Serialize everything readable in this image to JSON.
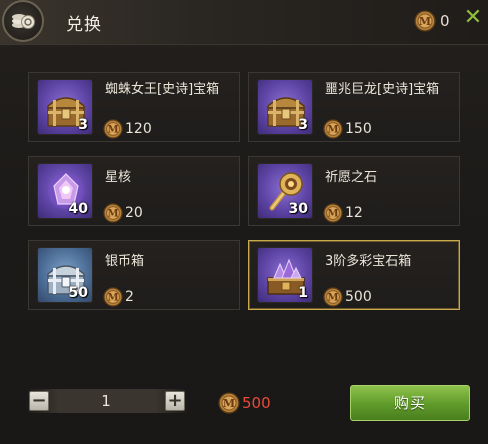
{
  "header": {
    "title": "兑换",
    "balance": "0",
    "close_symbol": "✕"
  },
  "items": [
    {
      "name": "蜘蛛女王[史诗]宝箱",
      "qty": "3",
      "price": "120",
      "icon": "spider-queen-chest-icon"
    },
    {
      "name": "噩兆巨龙[史诗]宝箱",
      "qty": "3",
      "price": "150",
      "icon": "omen-dragon-chest-icon"
    },
    {
      "name": "星核",
      "qty": "40",
      "price": "20",
      "icon": "star-core-icon"
    },
    {
      "name": "祈愿之石",
      "qty": "30",
      "price": "12",
      "icon": "wish-stone-icon"
    },
    {
      "name": "银币箱",
      "qty": "50",
      "price": "2",
      "icon": "silver-coin-chest-icon"
    },
    {
      "name": "3阶多彩宝石箱",
      "qty": "1",
      "price": "500",
      "icon": "gem-chest-icon",
      "selected": true
    }
  ],
  "footer": {
    "minus": "−",
    "plus": "+",
    "quantity": "1",
    "total": "500",
    "buy_label": "购买"
  },
  "colors": {
    "accent_gold": "#c9a94f",
    "buy_green": "#6aa534",
    "total_red": "#e84a3a",
    "close_green": "#8fbf3a"
  }
}
